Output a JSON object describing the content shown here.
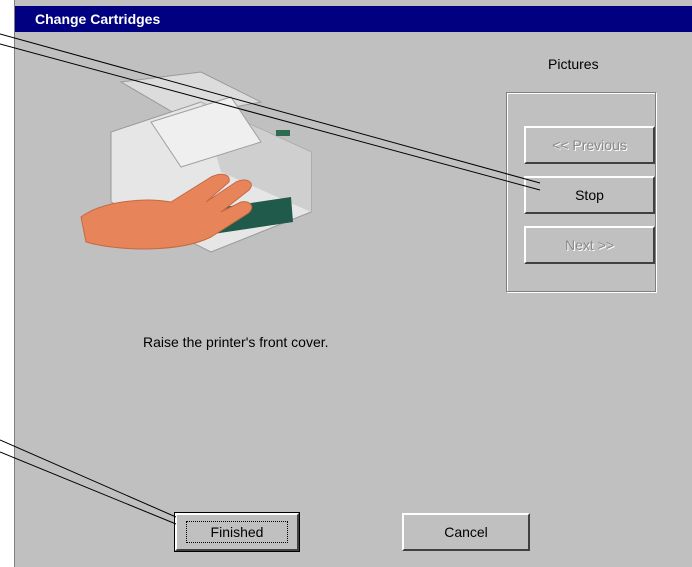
{
  "window": {
    "title": "Change Cartridges"
  },
  "pictures": {
    "label": "Pictures",
    "previous_label": "<< Previous",
    "stop_label": "Stop",
    "next_label": "Next >>"
  },
  "message": "Raise the printer's front cover.",
  "buttons": {
    "finished_label": "Finished",
    "cancel_label": "Cancel"
  },
  "colors": {
    "titlebar": "#000080",
    "dialog_bg": "#c0c0c0",
    "hand": "#e8845a",
    "tray": "#1f5a4a"
  },
  "icons": [
    "printer-illustration"
  ]
}
